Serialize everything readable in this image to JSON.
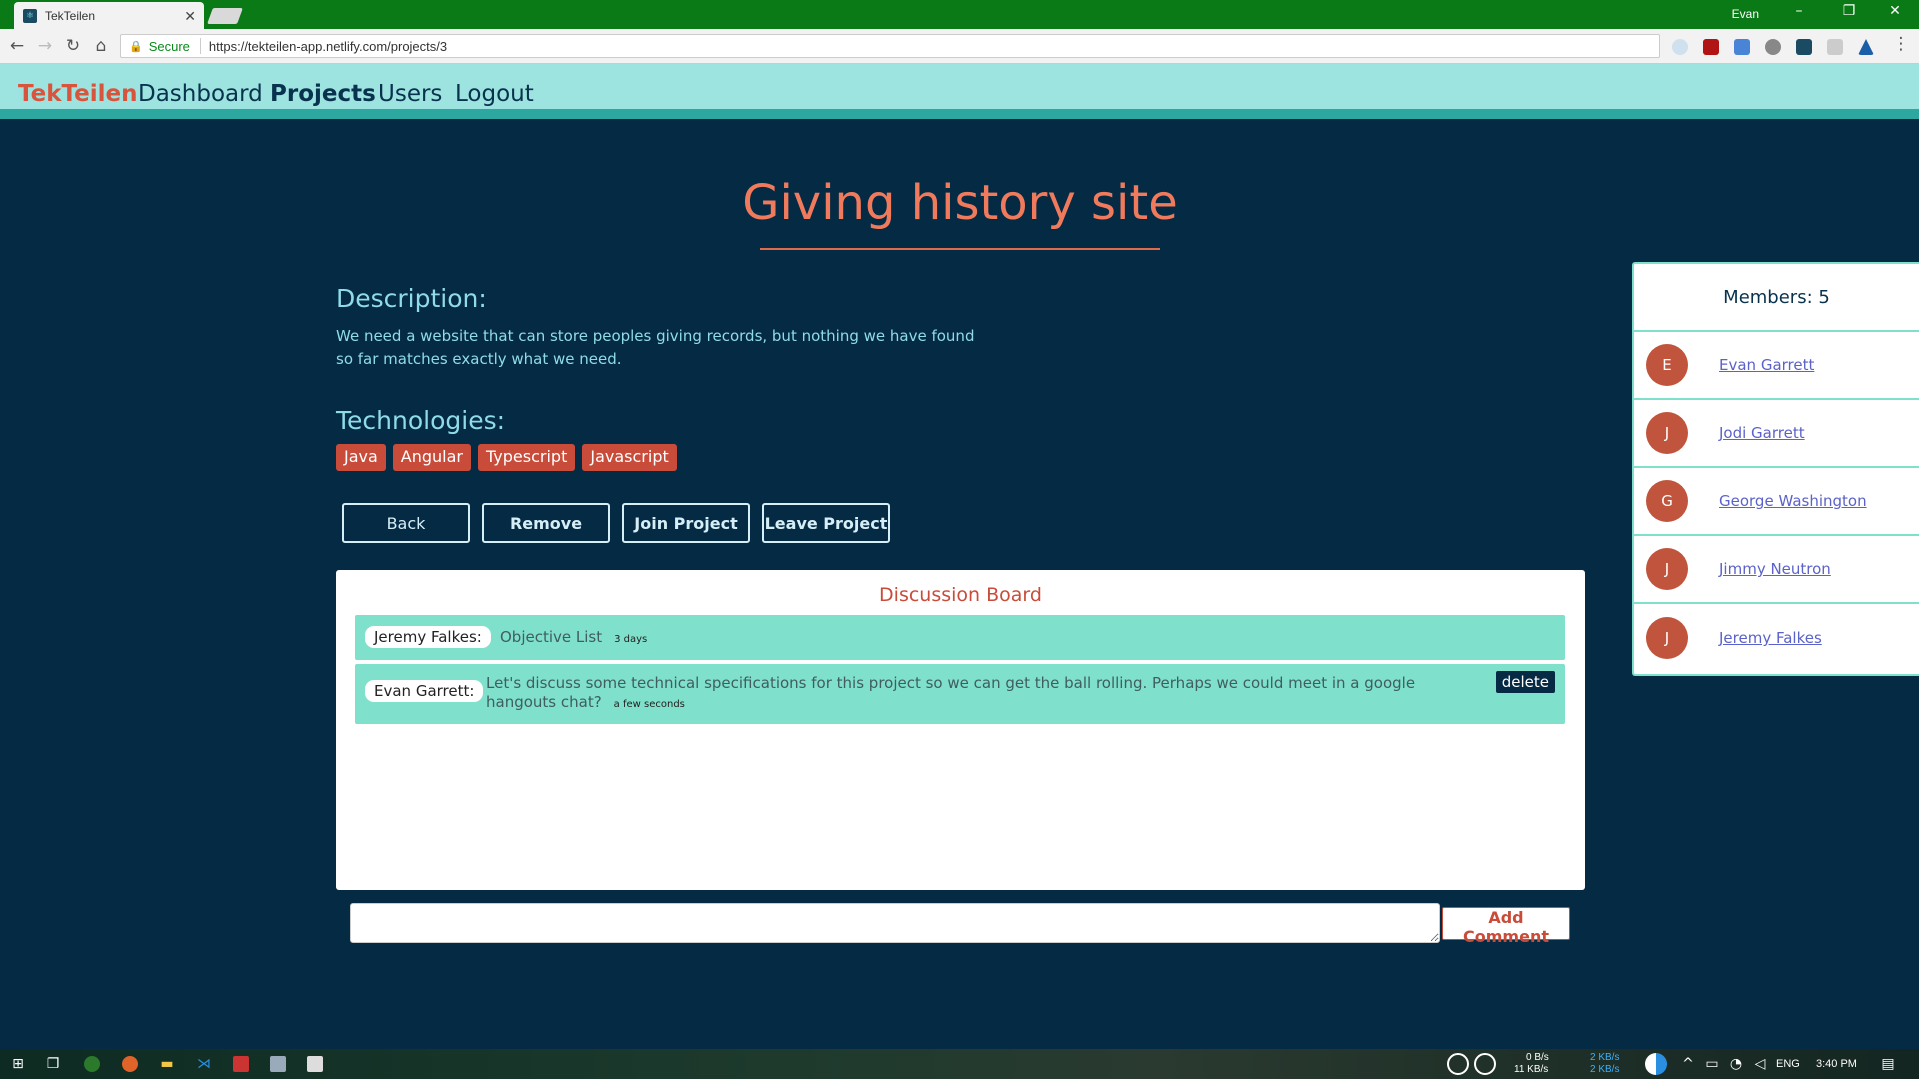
{
  "browser": {
    "tab_title": "TekTeilen",
    "close_glyph": "✕",
    "user": "Evan",
    "secure_label": "Secure",
    "url": "https://tekteilen-app.netlify.com/projects/3"
  },
  "nav": {
    "brand": "TekTeilen",
    "links": [
      "Dashboard",
      "Projects",
      "Users",
      "Logout"
    ],
    "active": "Projects"
  },
  "project": {
    "title": "Giving history site",
    "description_heading": "Description:",
    "description": "We need a website that can store peoples giving records, but nothing we have found so far matches exactly what we need.",
    "technologies_heading": "Technologies:",
    "technologies": [
      "Java",
      "Angular",
      "Typescript",
      "Javascript"
    ]
  },
  "actions": {
    "back": "Back",
    "remove": "Remove",
    "join": "Join Project",
    "leave": "Leave Project"
  },
  "board": {
    "title": "Discussion Board",
    "comments": [
      {
        "author": "Jeremy Falkes:",
        "text": "Objective List",
        "time": "3 days"
      },
      {
        "author": "Evan Garrett:",
        "text": "Let's discuss some technical specifications for this project so we can get the ball rolling. Perhaps we could meet in a google hangouts chat?",
        "time": "a few seconds",
        "delete_label": "delete"
      }
    ],
    "input_placeholder": "",
    "add_comment_label": "Add Comment"
  },
  "members": {
    "heading": "Members: 5",
    "list": [
      {
        "initial": "E",
        "name": "Evan Garrett"
      },
      {
        "initial": "J",
        "name": "Jodi Garrett"
      },
      {
        "initial": "G",
        "name": "George Washington"
      },
      {
        "initial": "J",
        "name": "Jimmy Neutron"
      },
      {
        "initial": "J",
        "name": "Jeremy Falkes"
      }
    ]
  },
  "taskbar": {
    "net_up": "0 B/s",
    "net_down": "11 KB/s",
    "net2_a": "2 KB/s",
    "net2_b": "2 KB/s",
    "lang": "ENG",
    "clock": "3:40 PM"
  },
  "colors": {
    "page_bg": "#052a44",
    "nav_bg": "#9de3df",
    "accent": "#c94c3a",
    "comment_bg": "#7fe0cb"
  }
}
